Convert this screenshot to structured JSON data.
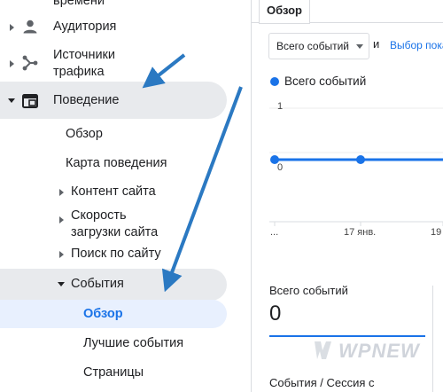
{
  "sidebar": {
    "top_cut_label": "времени",
    "audience": "Аудитория",
    "traffic_line1": "Источники",
    "traffic_line2": "трафика",
    "behavior": "Поведение",
    "overview": "Обзор",
    "behavior_map": "Карта поведения",
    "site_content": "Контент сайта",
    "speed_line1": "Скорость",
    "speed_line2": "загрузки сайта",
    "site_search": "Поиск по сайту",
    "events": "События",
    "events_overview": "Обзор",
    "top_events": "Лучшие события",
    "pages": "Страницы"
  },
  "main": {
    "tab_label": "Обзор",
    "select_value": "Всего событий",
    "and_text": "и",
    "select_link": "Выбор пока",
    "legend_label": "Всего событий",
    "y_ticks": [
      "1",
      "0"
    ],
    "x_ticks": [
      "...",
      "17 янв.",
      "19"
    ],
    "metric_label": "Всего событий",
    "metric_value": "0",
    "metric2_label": "События / Сессия с"
  },
  "chart_data": {
    "type": "line",
    "x": [
      "...",
      "17 янв.",
      "19"
    ],
    "series": [
      {
        "name": "Всего событий",
        "values": [
          0,
          0,
          0
        ]
      }
    ],
    "ylim": [
      0,
      1
    ],
    "grid": true
  },
  "watermark": "WPNEW",
  "colors": {
    "accent": "#1a73e8",
    "arrow": "#2b79c2",
    "highlight": "#e8eaed",
    "selected": "#e8f0fe"
  }
}
